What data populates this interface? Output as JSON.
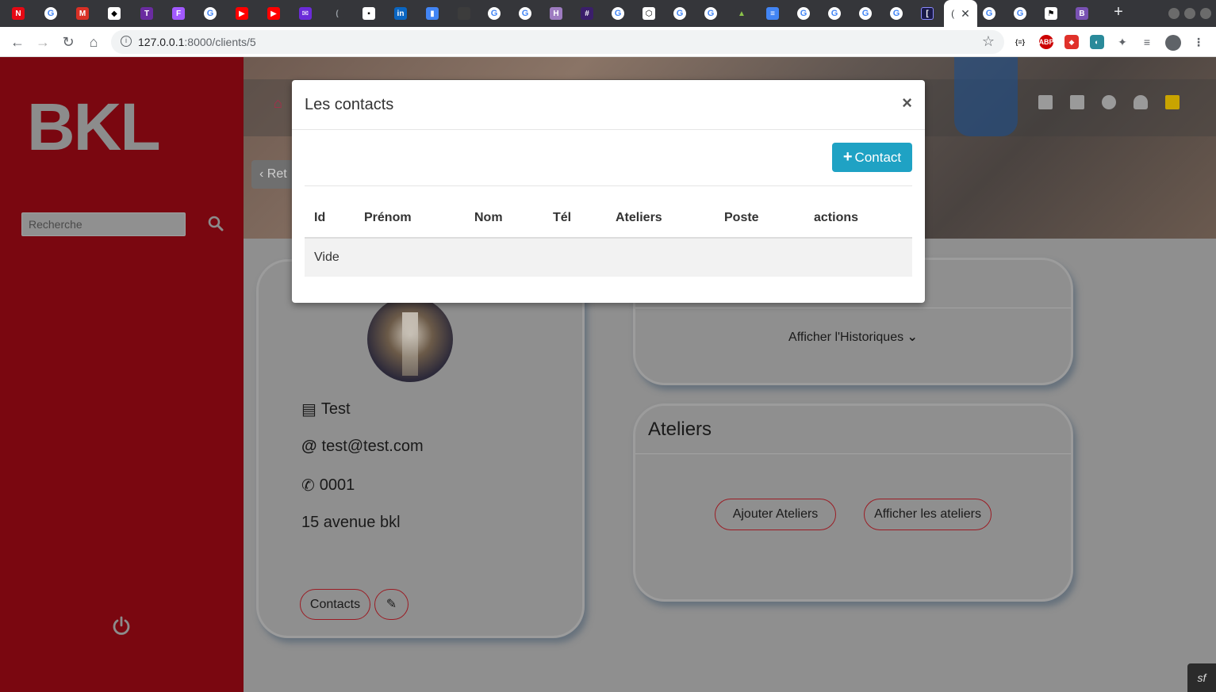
{
  "browser": {
    "url_host": "127.0.0.1",
    "url_rest": ":8000/clients/5",
    "tab_count": 31
  },
  "sidebar": {
    "logo": "BKL",
    "search_placeholder": "Recherche"
  },
  "hero": {
    "back_label": "Ret"
  },
  "profile": {
    "name": "Test",
    "email": "test@test.com",
    "phone": "0001",
    "address": "15 avenue bkl",
    "contacts_button": "Contacts"
  },
  "history": {
    "toggle_label": "Afficher l'Historiques"
  },
  "ateliers": {
    "title": "Ateliers",
    "add_button": "Ajouter Ateliers",
    "show_button": "Afficher les ateliers"
  },
  "modal": {
    "title": "Les contacts",
    "close": "×",
    "add_button": "Contact",
    "columns": [
      "Id",
      "Prénom",
      "Nom",
      "Tél",
      "Ateliers",
      "Poste",
      "actions"
    ],
    "empty_text": "Vide"
  },
  "colors": {
    "sidebar": "#7a0710",
    "accent": "#1fa2c4",
    "button_border": "#9b1c24"
  }
}
